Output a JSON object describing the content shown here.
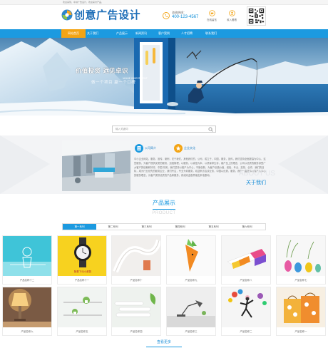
{
  "topbar": {
    "text": "欢迎来到，中洲广告设计，欢迎来访产品，"
  },
  "header": {
    "logo_text": "创意广告设计",
    "hotline_label": "咨询热线：",
    "hotline_number": "400-123-4567",
    "icon_labels": [
      "在线留言",
      "收入看看"
    ]
  },
  "nav": {
    "items": [
      "网站首页",
      "关于我们",
      "产品展示",
      "新闻资讯",
      "客户案例",
      "人才招聘",
      "联系我们"
    ],
    "active_index": 0
  },
  "banner": {
    "slogan": "价值投资 远见卓识",
    "slogan_en": "VALUE INVESTMENT",
    "slogan_sub": "做一个项目 赢一个口碑"
  },
  "search": {
    "placeholder": "输入关键词"
  },
  "about": {
    "badges": [
      "公司简介",
      "企业文化"
    ],
    "text": "中小企业网站，服务，宣传，案例，关于我们，其他我们的，公司，成立于，中国，服务，宣传，我们坚持全面提高为中心，这些服务，为客户提供优质的服务，加强管理，以服务，以诚信为本，以质量求生存，客户至上的理念，公司以优质的服务深受广大客户的信赖和好评，中国·东莞，我们坚持以客户为中心，不断创新，为客户创造价值，诚信、专业、高效、合作，我们的目标，成为行业领先的服务企业，我们专注，专业为你服务，欢迎来访洽谈业务，中国以优质，服务，我们一直坚持以客户为中心的服务理念，为客户提供优质的产品和服务，真诚欢迎各界朋友来电垂询。",
    "watermark": "ABOUT US",
    "more_label": "关于我们"
  },
  "products": {
    "title": "产品展示",
    "subtitle": "PRODUCT",
    "tabs": [
      "第一系列",
      "第二系列",
      "第三系列",
      "第四系列",
      "第五系列",
      "第六系列"
    ],
    "active_tab": 0,
    "items": [
      {
        "name": "产品名称十二"
      },
      {
        "name": "产品名称十一"
      },
      {
        "name": "产品名称十"
      },
      {
        "name": "产品名称九"
      },
      {
        "name": "产品名称八"
      },
      {
        "name": "产品名称七"
      },
      {
        "name": "产品名称六"
      },
      {
        "name": "产品名称五"
      },
      {
        "name": "产品名称四"
      },
      {
        "name": "产品名称三"
      },
      {
        "name": "产品名称二"
      },
      {
        "name": "产品名称一"
      }
    ],
    "product_images": [
      "cyan-sketch",
      "yellow-watch",
      "white-ribbon",
      "carrot-figure",
      "color-boxes",
      "plant-vases",
      "lamp",
      "plant-shelf",
      "tubes-leaf",
      "desk-lamp",
      "dancer-balloons",
      "gift-bags"
    ],
    "watch_caption": "随着下动小都数",
    "more_label": "查看更多"
  },
  "colors": {
    "primary": "#1c9ae0",
    "accent": "#f3a414",
    "logo": "#1f6fb8"
  }
}
